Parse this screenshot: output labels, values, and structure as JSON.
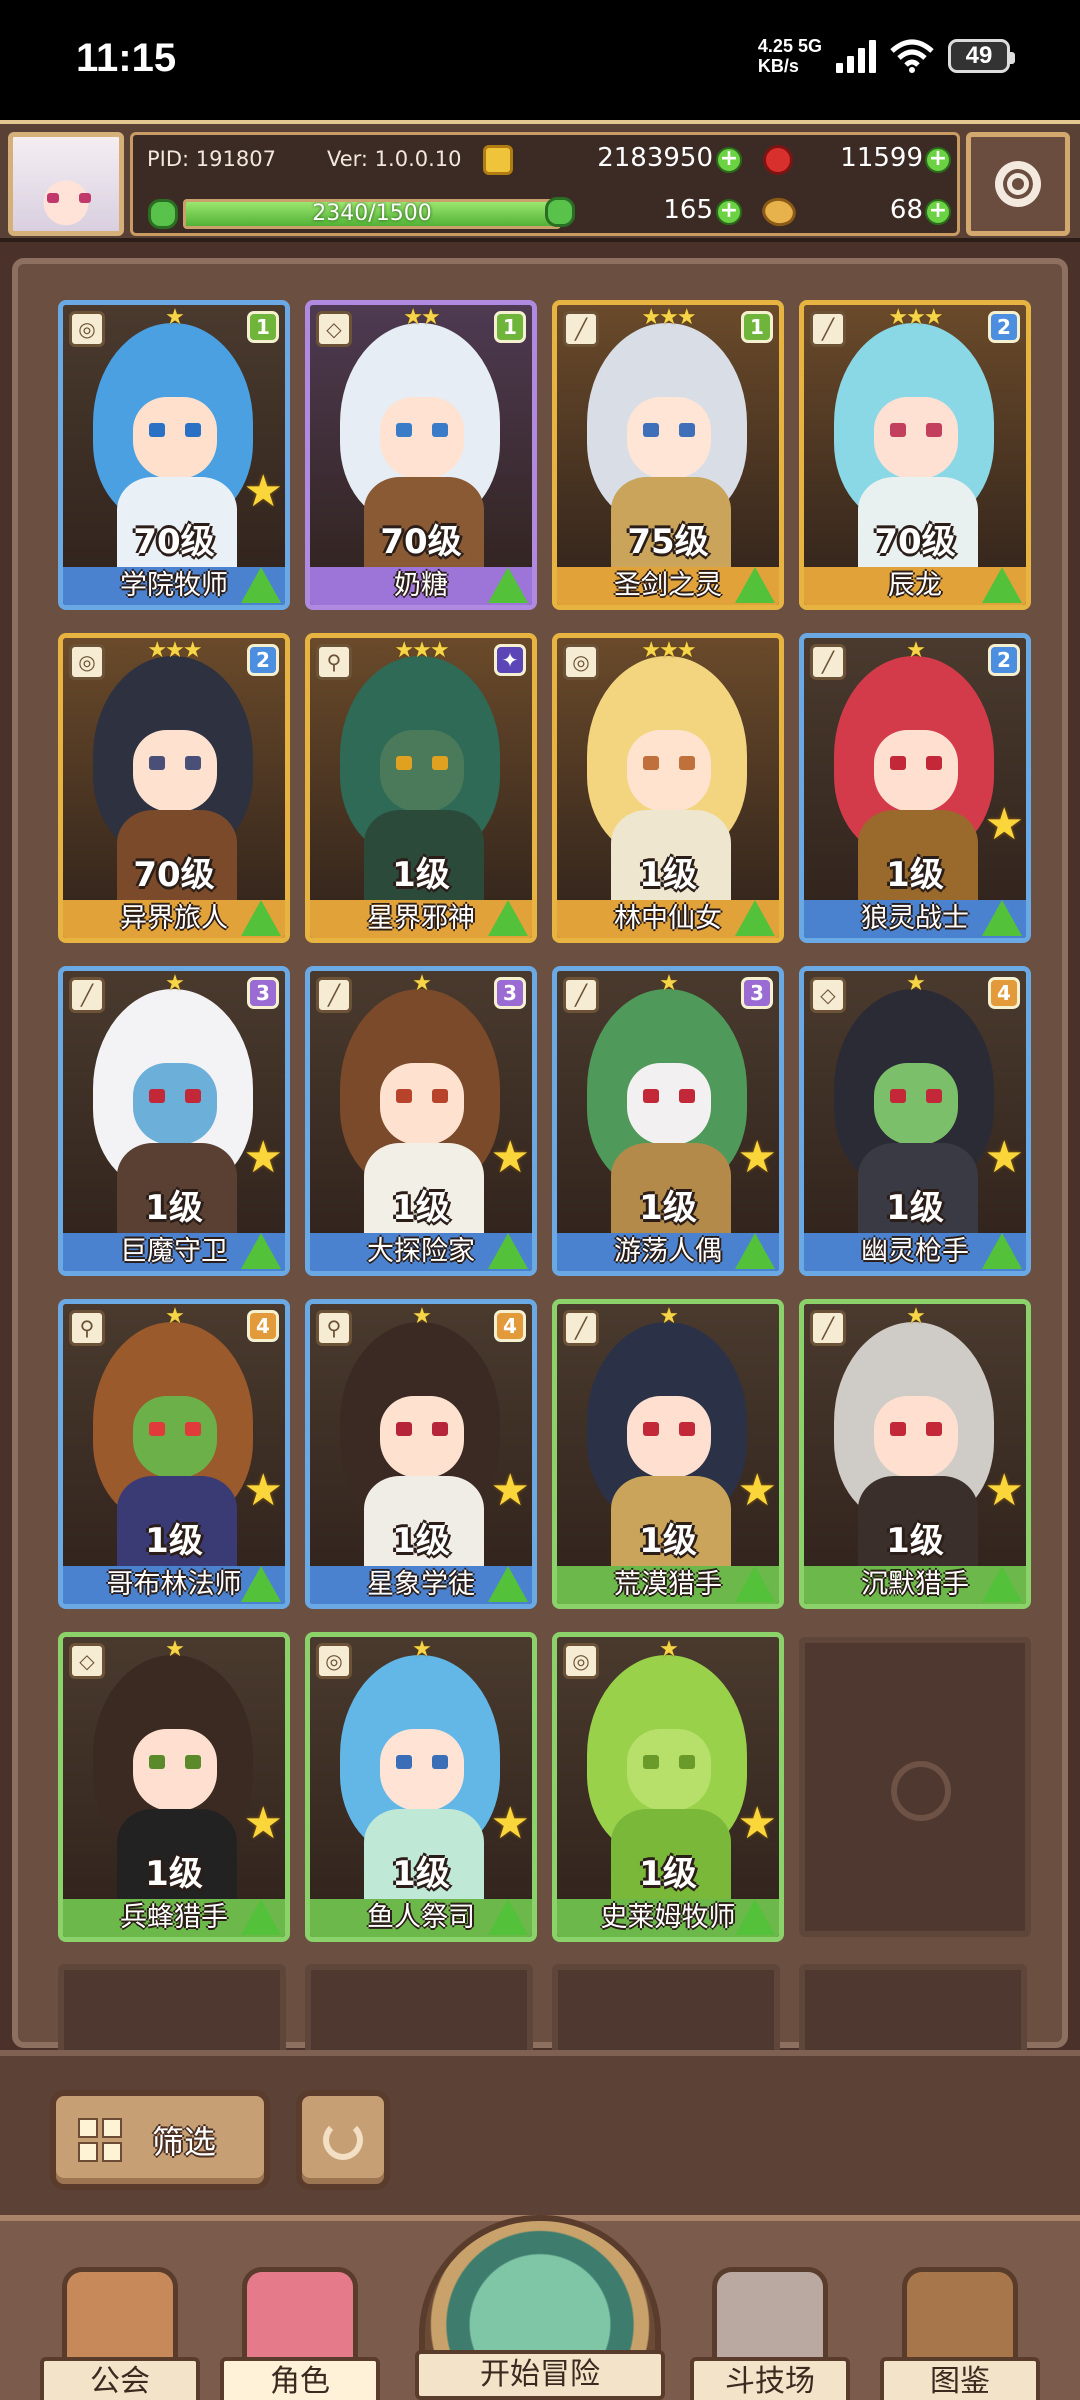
{
  "status_bar": {
    "time": "11:15",
    "network_speed": "4.25",
    "network_unit": "KB/s",
    "network_type": "5G",
    "battery": "49"
  },
  "header": {
    "pid": "PID: 191807",
    "version": "Ver: 1.0.0.10",
    "exp_text": "2340/1500",
    "exp_progress": 1.0,
    "gold": "2183950",
    "gems": "11599",
    "clover": "165",
    "bread": "68"
  },
  "characters": [
    {
      "name": "学院牧师",
      "level": "70级",
      "stars": "★",
      "rank": "1",
      "rarity": "blue",
      "type_glyph": "◎",
      "hair": "#4aa0e0",
      "skin": "#ffe0cc",
      "eye": "#2a70c4",
      "outfit": "#e9f1f7",
      "upgrade_star": true
    },
    {
      "name": "奶糖",
      "level": "70级",
      "stars": "★★",
      "rank": "1",
      "rarity": "purple",
      "type_glyph": "◇",
      "hair": "#e6edf4",
      "skin": "#ffe2d2",
      "eye": "#3b7cc9",
      "outfit": "#8a5a35",
      "upgrade_star": false
    },
    {
      "name": "圣剑之灵",
      "level": "75级",
      "stars": "★★★",
      "rank": "1",
      "rarity": "gold",
      "type_glyph": "╱",
      "hair": "#d8dde6",
      "skin": "#ffe5d6",
      "eye": "#3f6fb8",
      "outfit": "#c9a45a",
      "upgrade_star": false
    },
    {
      "name": "辰龙",
      "level": "70级",
      "stars": "★★★",
      "rank": "2",
      "rarity": "gold",
      "type_glyph": "╱",
      "hair": "#8ad7e6",
      "skin": "#ffe1d4",
      "eye": "#c23f5e",
      "outfit": "#e8f0f0",
      "upgrade_star": false
    },
    {
      "name": "异界旅人",
      "level": "70级",
      "stars": "★★★",
      "rank": "2",
      "rarity": "gold",
      "type_glyph": "◎",
      "hair": "#2d3140",
      "skin": "#ffe1d0",
      "eye": "#4a4f78",
      "outfit": "#7a4a2a",
      "upgrade_star": false
    },
    {
      "name": "星界邪神",
      "level": "1级",
      "stars": "★★★",
      "rank": "✦",
      "rarity": "gold",
      "type_glyph": "⚲",
      "hair": "#2f6a57",
      "skin": "#4a7a5a",
      "eye": "#e0a020",
      "outfit": "#2b4a3a",
      "upgrade_star": false
    },
    {
      "name": "林中仙女",
      "level": "1级",
      "stars": "★★★",
      "rank": "",
      "rarity": "gold",
      "type_glyph": "◎",
      "hair": "#f2d57e",
      "skin": "#ffe3cf",
      "eye": "#c0703a",
      "outfit": "#eee6cf",
      "upgrade_star": false
    },
    {
      "name": "狼灵战士",
      "level": "1级",
      "stars": "★",
      "rank": "2",
      "rarity": "blue",
      "type_glyph": "╱",
      "hair": "#d33b4a",
      "skin": "#ffe0d0",
      "eye": "#c22838",
      "outfit": "#9a6a2c",
      "upgrade_star": true
    },
    {
      "name": "巨魔守卫",
      "level": "1级",
      "stars": "★",
      "rank": "3",
      "rarity": "blue",
      "type_glyph": "╱",
      "hair": "#f3f3f6",
      "skin": "#6cb0d9",
      "eye": "#c22838",
      "outfit": "#5a4032",
      "upgrade_star": true
    },
    {
      "name": "大探险家",
      "level": "1级",
      "stars": "★",
      "rank": "3",
      "rarity": "blue",
      "type_glyph": "╱",
      "hair": "#7a4a2a",
      "skin": "#ffe1d0",
      "eye": "#b6432a",
      "outfit": "#f2efe6",
      "upgrade_star": true
    },
    {
      "name": "游荡人偶",
      "level": "1级",
      "stars": "★",
      "rank": "3",
      "rarity": "blue",
      "type_glyph": "╱",
      "hair": "#4f9a5a",
      "skin": "#f2f0f0",
      "eye": "#c22838",
      "outfit": "#b48a4a",
      "upgrade_star": true
    },
    {
      "name": "幽灵枪手",
      "level": "1级",
      "stars": "★",
      "rank": "4",
      "rarity": "blue",
      "type_glyph": "◇",
      "hair": "#2b2b36",
      "skin": "#7bbf6a",
      "eye": "#c22838",
      "outfit": "#3a3a44",
      "upgrade_star": true
    },
    {
      "name": "哥布林法师",
      "level": "1级",
      "stars": "★",
      "rank": "4",
      "rarity": "blue",
      "type_glyph": "⚲",
      "hair": "#9a5a2c",
      "skin": "#6cb04a",
      "eye": "#e03a3a",
      "outfit": "#3a3a74",
      "upgrade_star": true
    },
    {
      "name": "星象学徒",
      "level": "1级",
      "stars": "★",
      "rank": "4",
      "rarity": "blue",
      "type_glyph": "⚲",
      "hair": "#3b2a24",
      "skin": "#ffe1d0",
      "eye": "#b6243a",
      "outfit": "#f0ece6",
      "upgrade_star": true
    },
    {
      "name": "荒漠猎手",
      "level": "1级",
      "stars": "★",
      "rank": "",
      "rarity": "green",
      "type_glyph": "╱",
      "hair": "#2b3248",
      "skin": "#ffe0d0",
      "eye": "#c22838",
      "outfit": "#c9a45a",
      "upgrade_star": true
    },
    {
      "name": "沉默猎手",
      "level": "1级",
      "stars": "★",
      "rank": "",
      "rarity": "green",
      "type_glyph": "╱",
      "hair": "#cfcbc6",
      "skin": "#ffe0d0",
      "eye": "#c22838",
      "outfit": "#3a2f2a",
      "upgrade_star": true
    },
    {
      "name": "兵蜂猎手",
      "level": "1级",
      "stars": "★",
      "rank": "",
      "rarity": "green",
      "type_glyph": "◇",
      "hair": "#3a2a22",
      "skin": "#ffe0d0",
      "eye": "#5a8a2a",
      "outfit": "#222222",
      "upgrade_star": true
    },
    {
      "name": "鱼人祭司",
      "level": "1级",
      "stars": "★",
      "rank": "",
      "rarity": "green",
      "type_glyph": "◎",
      "hair": "#62b7e6",
      "skin": "#ffe3d4",
      "eye": "#3a6fb8",
      "outfit": "#bfe8d6",
      "upgrade_star": true
    },
    {
      "name": "史莱姆牧师",
      "level": "1级",
      "stars": "★",
      "rank": "",
      "rarity": "green",
      "type_glyph": "◎",
      "hair": "#9ad14a",
      "skin": "#b7e06a",
      "eye": "#6a9a2a",
      "outfit": "#7ab83a",
      "upgrade_star": true
    }
  ],
  "filter": {
    "label": "筛选"
  },
  "nav": {
    "guild": "公会",
    "character": "角色",
    "adventure": "开始冒险",
    "arena": "斗技场",
    "codex": "图鉴"
  }
}
